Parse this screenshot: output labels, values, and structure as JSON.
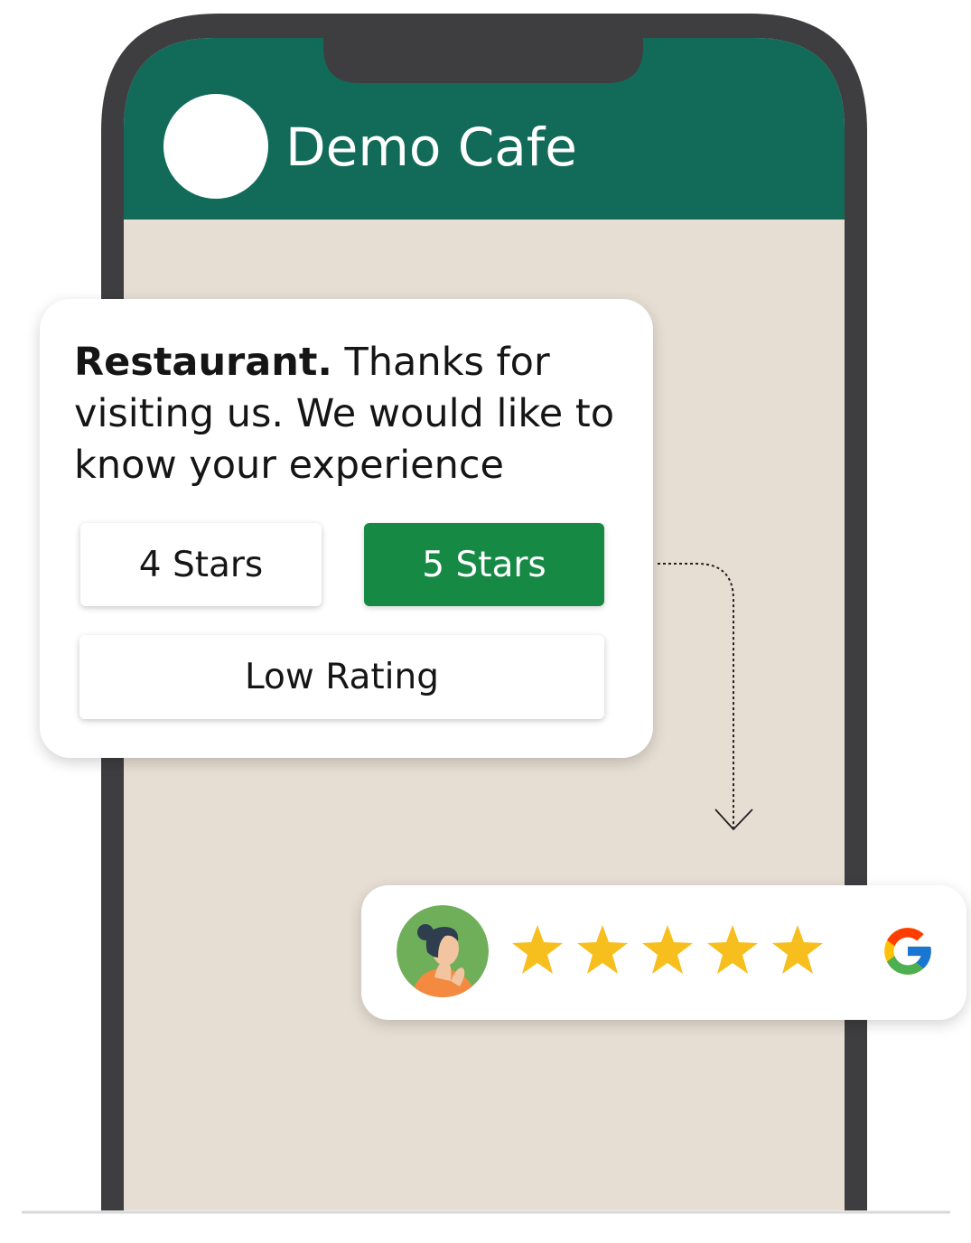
{
  "header": {
    "title": "Demo Cafe"
  },
  "message": {
    "bold": "Restaurant.",
    "text": " Thanks for visiting us. We would like to know your experience"
  },
  "buttons": {
    "four_stars": "4 Stars",
    "five_stars": "5 Stars",
    "low_rating": "Low Rating"
  },
  "review": {
    "stars": 5,
    "platform_icon": "google-icon"
  },
  "colors": {
    "header": "#126A59",
    "chat_background": "#E6DED3",
    "phone_frame": "#3E3E40",
    "selected_button": "#168945",
    "star": "#F7BF1E"
  }
}
